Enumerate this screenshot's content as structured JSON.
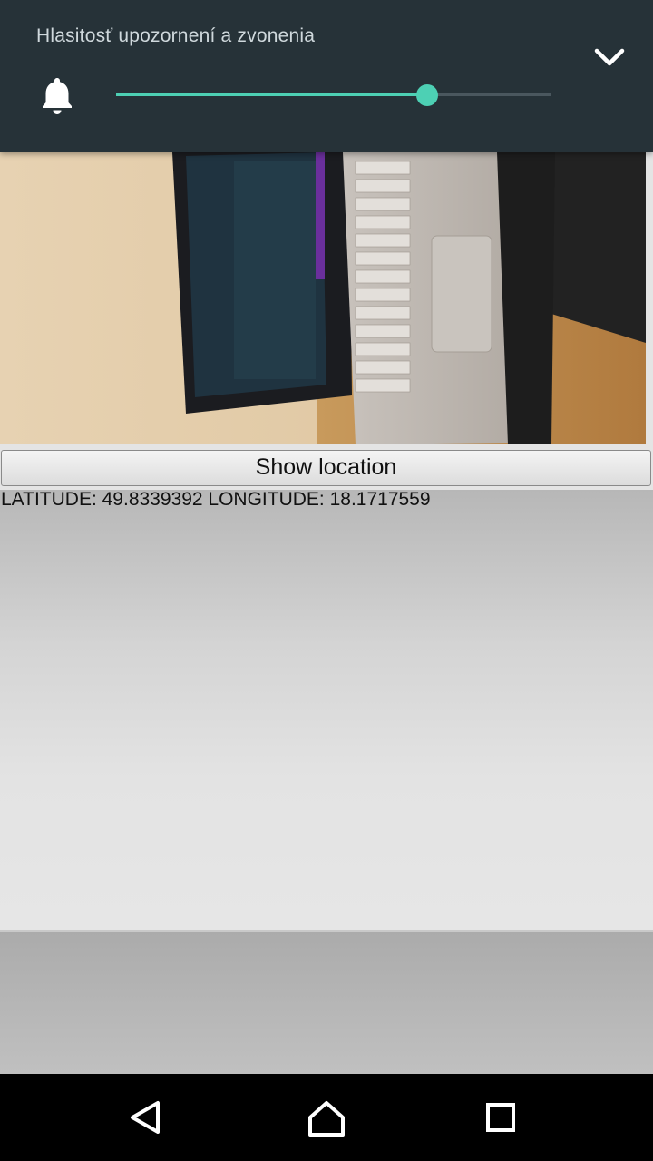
{
  "volume_panel": {
    "title": "Hlasitosť upozornení a zvonenia",
    "level_fraction": 0.715,
    "accent_color": "#4dd0b4",
    "bell_icon": "bell-icon",
    "collapse_icon": "chevron-down-icon"
  },
  "photo": {
    "description_icon": "laptop-photo"
  },
  "location": {
    "button_label": "Show location",
    "coords_text": "LATITUDE: 49.8339392 LONGITUDE: 18.1717559"
  },
  "navbar": {
    "back_icon": "back-icon",
    "home_icon": "home-icon",
    "recents_icon": "recents-icon"
  }
}
